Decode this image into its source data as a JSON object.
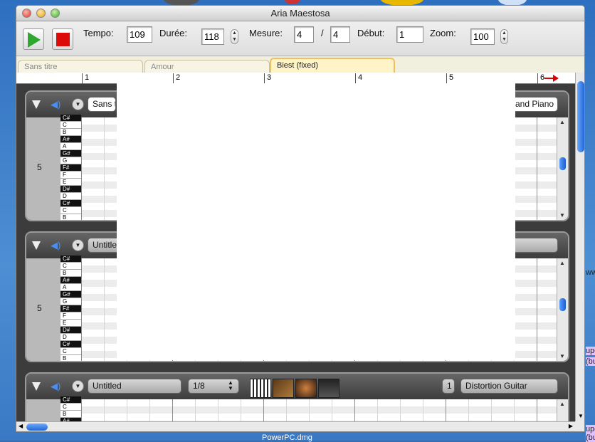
{
  "window": {
    "title": "Aria Maestosa"
  },
  "toolbar": {
    "tempo_label": "Tempo:",
    "tempo_value": "109",
    "duree_label": "Durée:",
    "duree_value": "118",
    "mesure_label": "Mesure:",
    "mesure_num": "4",
    "mesure_sep": "/",
    "mesure_den": "4",
    "debut_label": "Début:",
    "debut_value": "1",
    "zoom_label": "Zoom:",
    "zoom_value": "100"
  },
  "tabs": [
    {
      "label": "Sans titre"
    },
    {
      "label": "Amour"
    },
    {
      "label": "Biest (fixed)",
      "active": true
    }
  ],
  "ruler": {
    "measures": [
      "1",
      "2",
      "3",
      "4",
      "5",
      "6"
    ]
  },
  "tracks": [
    {
      "name": "Sans t",
      "instrument": "and Piano",
      "octave": "5"
    },
    {
      "name": "Untitled",
      "octave": "5"
    },
    {
      "name": "Untitled",
      "grid": "1/8",
      "channel": "1",
      "instrument": "Distortion Guitar"
    }
  ],
  "keys": [
    "C#",
    "C",
    "B",
    "A#",
    "A",
    "G#",
    "G",
    "F#",
    "F",
    "E",
    "D#",
    "D",
    "C#",
    "C",
    "B"
  ],
  "desktop": {
    "file_label": "PowerPC.dmg",
    "side_text_1": "upe",
    "side_text_2": "(bu",
    "side_text_3": "ww"
  },
  "colors": {
    "accent": "#2266d6",
    "stop": "#dd0a0a",
    "play": "#2ea82e",
    "active_tab": "#f0c060"
  }
}
